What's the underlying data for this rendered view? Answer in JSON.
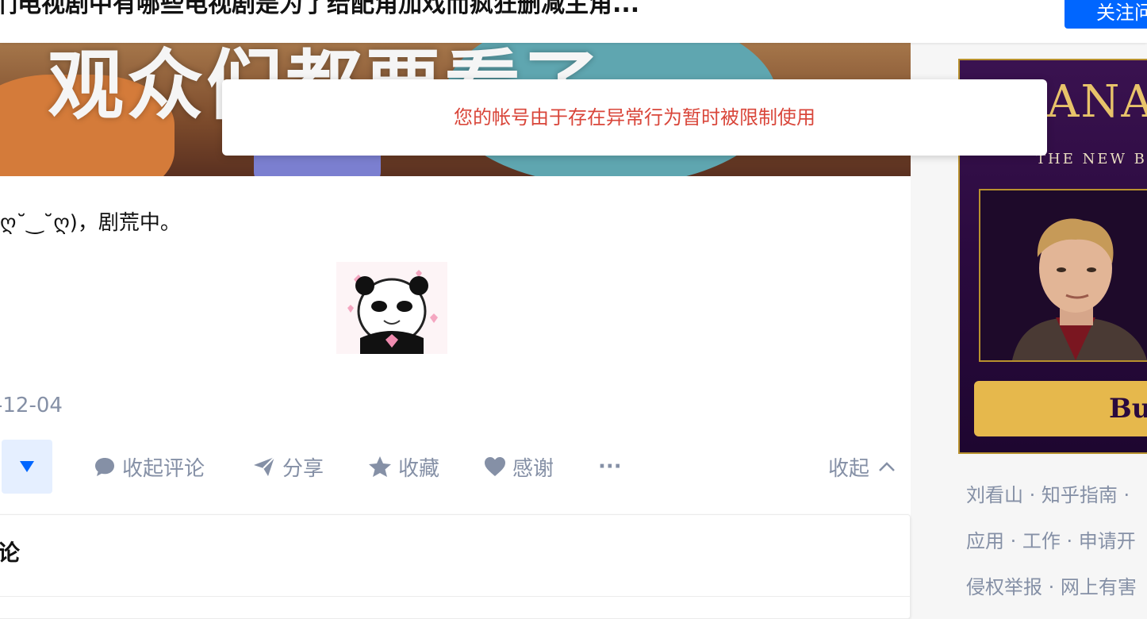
{
  "header": {
    "title": "们电视剧中有哪些电视剧是为了给配角加戏而疯狂删减主角...",
    "follow_label": "关注问"
  },
  "toast": {
    "message": "您的帐号由于存在异常行为暂时被限制使用"
  },
  "answer": {
    "banner_text": "观众们都要看了",
    "text": "ღ˘‿˘ღ)，剧荒中。",
    "date": "-12-04",
    "actions": {
      "comment": "收起评论",
      "share": "分享",
      "favorite": "收藏",
      "thanks": "感谢",
      "more": "···",
      "collapse": "收起"
    }
  },
  "comments": {
    "title": "论"
  },
  "sidebar": {
    "ad": {
      "title": "ANA",
      "subtitle": "THE NEW B",
      "button": "Bu"
    },
    "footer": [
      "刘看山 · 知乎指南 ·",
      "应用 · 工作 · 申请开",
      "侵权举报 · 网上有害"
    ]
  },
  "colors": {
    "accent": "#0066ff",
    "muted": "#8590a6",
    "error": "#d9463a"
  }
}
